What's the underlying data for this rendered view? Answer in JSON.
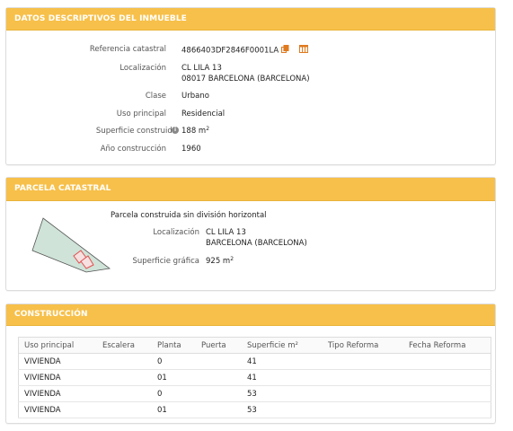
{
  "datos": {
    "title": "DATOS DESCRIPTIVOS DEL INMUEBLE",
    "referencia_label": "Referencia catastral",
    "referencia_value": "4866403DF2846F0001LA",
    "localizacion_label": "Localización",
    "localizacion_line1": "CL LILA 13",
    "localizacion_line2": "08017 BARCELONA (BARCELONA)",
    "clase_label": "Clase",
    "clase_value": "Urbano",
    "uso_label": "Uso principal",
    "uso_value": "Residencial",
    "superficie_label": "Superficie construida",
    "superficie_value": "188 m",
    "superficie_sup": "2",
    "anio_label": "Año construcción",
    "anio_value": "1960"
  },
  "parcela": {
    "title": "PARCELA CATASTRAL",
    "description": "Parcela construida sin división horizontal",
    "localizacion_label": "Localización",
    "localizacion_line1": "CL LILA 13",
    "localizacion_line2": "BARCELONA (BARCELONA)",
    "superficie_label": "Superficie gráfica",
    "superficie_value": "925 m",
    "superficie_sup": "2"
  },
  "construccion": {
    "title": "CONSTRUCCIÓN",
    "headers": [
      "Uso principal",
      "Escalera",
      "Planta",
      "Puerta",
      "Superficie m²",
      "Tipo Reforma",
      "Fecha Reforma"
    ],
    "rows": [
      [
        "VIVIENDA",
        "",
        "0",
        "",
        "41",
        "",
        ""
      ],
      [
        "VIVIENDA",
        "",
        "01",
        "",
        "41",
        "",
        ""
      ],
      [
        "VIVIENDA",
        "",
        "0",
        "",
        "53",
        "",
        ""
      ],
      [
        "VIVIENDA",
        "",
        "01",
        "",
        "53",
        "",
        ""
      ]
    ]
  },
  "colors": {
    "header": "#f7c04a",
    "parcel_fill": "#cfe3d8",
    "building_outline": "#e05050"
  }
}
